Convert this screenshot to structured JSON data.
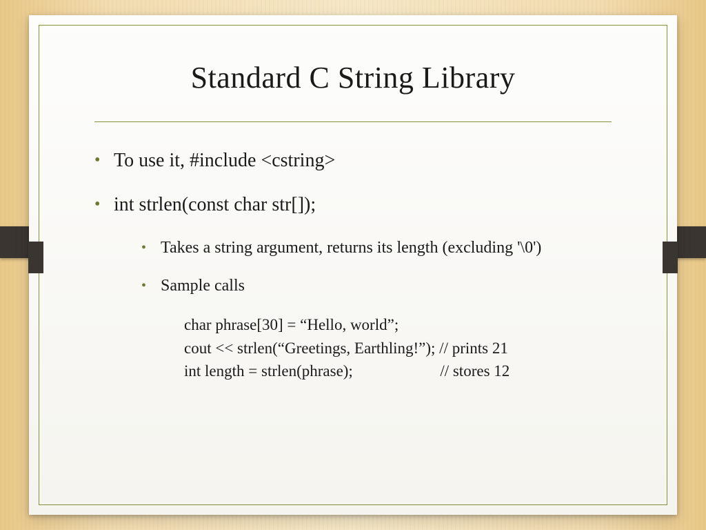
{
  "title": "Standard C String Library",
  "bullets": {
    "b1": "To use it, #include <cstring>",
    "b2": "int strlen(const char str[]);",
    "b2a": "Takes a string argument, returns its length (excluding '\\0')",
    "b2b": "Sample calls"
  },
  "code": "char phrase[30] = “Hello, world”;\ncout << strlen(“Greetings, Earthling!”); // prints 21\nint length = strlen(phrase);                      // stores 12"
}
